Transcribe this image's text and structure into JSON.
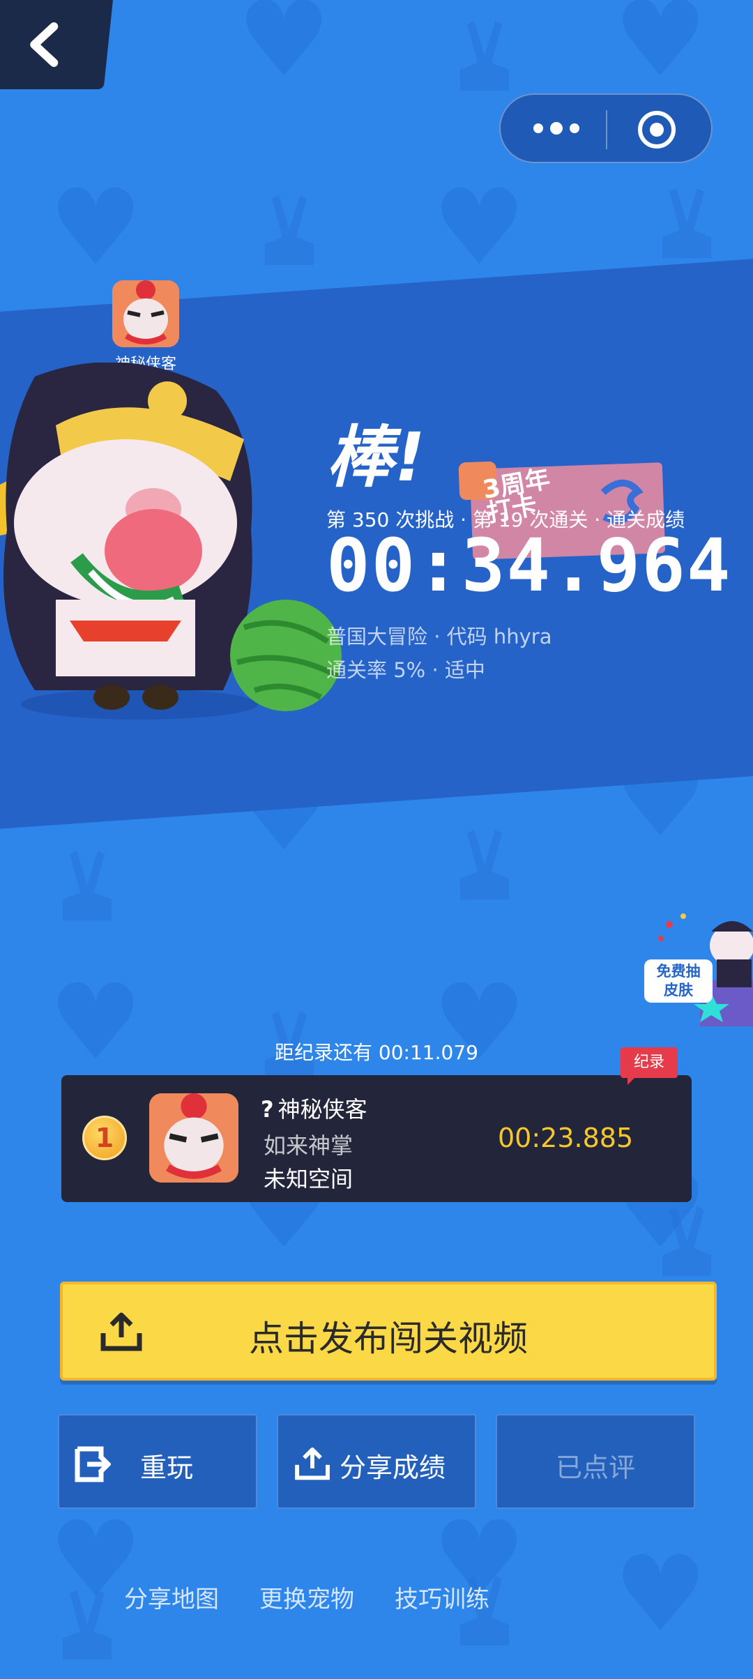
{
  "colors": {
    "background": "#2f86ea",
    "band": "#2563c9",
    "card": "#23263a",
    "accent_yellow": "#fbd846",
    "record_time": "#f7c82e",
    "record_tag": "#e63b4b"
  },
  "nav": {
    "back_icon": "chevron-left-icon"
  },
  "capsule": {
    "more_icon": "more-dots-icon",
    "close_icon": "target-circle-icon"
  },
  "player_mini": {
    "name": "神秘侠客",
    "title": "如来神掌"
  },
  "result": {
    "headline": "棒!",
    "stamp_text": "3周年\n打卡",
    "challenge_line": "第 350 次挑战 · 第 19 次通关 · 通关成绩",
    "time": "00:34.964",
    "map_line": "普国大冒险 · 代码 hhyra",
    "rate_line": "通关率 5% · 适中"
  },
  "promo": {
    "badge": "免费抽\n皮肤"
  },
  "record": {
    "gap_text": "距纪录还有 00:11.079",
    "tag": "纪录",
    "rank": "1",
    "name": "神秘侠客",
    "subtitle": "如来神掌",
    "map": "未知空间",
    "time": "00:23.885"
  },
  "actions": {
    "publish_label": "点击发布闯关视频",
    "replay_label": "重玩",
    "share_label": "分享成绩",
    "rated_label": "已点评"
  },
  "links": [
    "分享地图",
    "更换宠物",
    "技巧训练"
  ]
}
